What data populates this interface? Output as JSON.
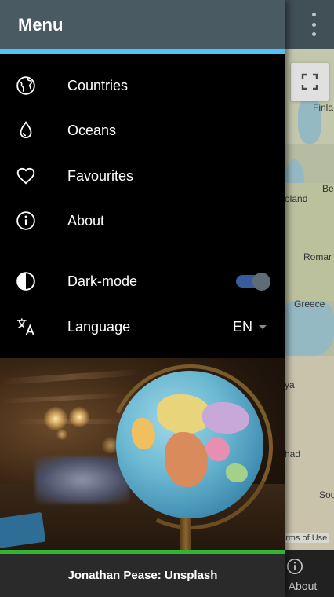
{
  "app_bar": {
    "overflow_icon": "more-vert-icon"
  },
  "map": {
    "labels": [
      "Finla",
      "Be",
      "oland",
      "Romar",
      "Greece",
      "ya",
      "had",
      "Sou"
    ],
    "fullscreen_icon": "fullscreen-icon",
    "terms": "erms of Use"
  },
  "bottom_nav": {
    "about_label": "About",
    "about_icon": "info-icon"
  },
  "drawer": {
    "title": "Menu",
    "accent_color": "#4fc3f7",
    "items": [
      {
        "label": "Countries",
        "icon": "globe-icon"
      },
      {
        "label": "Oceans",
        "icon": "droplet-icon"
      },
      {
        "label": "Favourites",
        "icon": "heart-icon"
      },
      {
        "label": "About",
        "icon": "info-icon"
      }
    ],
    "dark_mode": {
      "label": "Dark-mode",
      "icon": "contrast-icon",
      "enabled": true
    },
    "language": {
      "label": "Language",
      "icon": "translate-icon",
      "value": "EN"
    },
    "image_credit": "Jonathan Pease: Unsplash",
    "credit_accent_color": "#2fb52f"
  }
}
